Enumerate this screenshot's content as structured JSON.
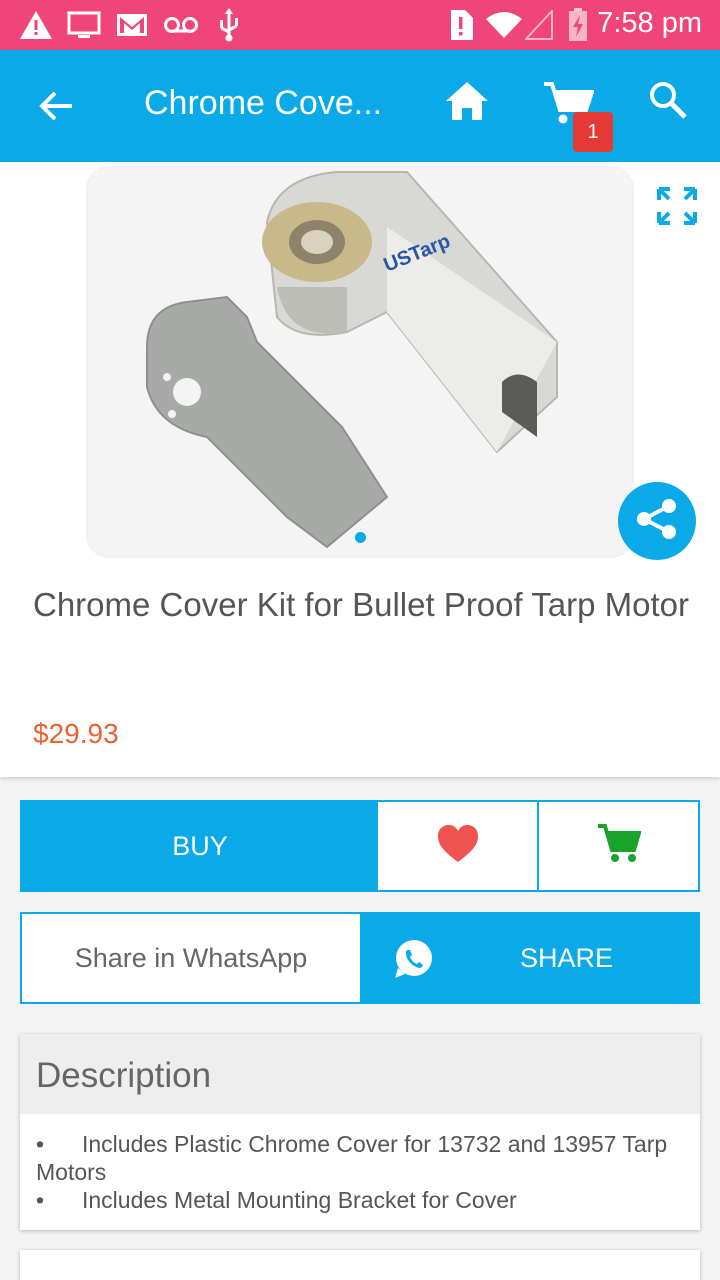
{
  "status_bar": {
    "time": "7:58 pm",
    "icons": [
      "warning-icon",
      "screen-icon",
      "gmail-icon",
      "voicemail-icon",
      "usb-icon",
      "alert-sim-icon",
      "wifi-icon",
      "signal-icon",
      "battery-charging-icon"
    ]
  },
  "app_bar": {
    "title": "Chrome Cove...",
    "cart_count": "1",
    "icons": [
      "back-arrow-icon",
      "home-icon",
      "cart-icon",
      "search-icon"
    ]
  },
  "product": {
    "title": "Chrome Cover Kit for Bullet Proof Tarp Motor",
    "price": "$29.93",
    "image_logo": "USTarp"
  },
  "actions": {
    "buy_label": "BUY",
    "share_whatsapp_label": "Share in WhatsApp",
    "share_label": "SHARE"
  },
  "description": {
    "heading": "Description",
    "items": [
      "Includes Plastic Chrome Cover for 13732 and 13957 Tarp Motors",
      "Includes Metal Mounting Bracket for Cover"
    ],
    "bullet": "•"
  },
  "colors": {
    "status_bar": "#f0457a",
    "primary": "#0aaae8",
    "price": "#e9622f",
    "heart": "#ef5350",
    "cart_green": "#1aa32a"
  }
}
